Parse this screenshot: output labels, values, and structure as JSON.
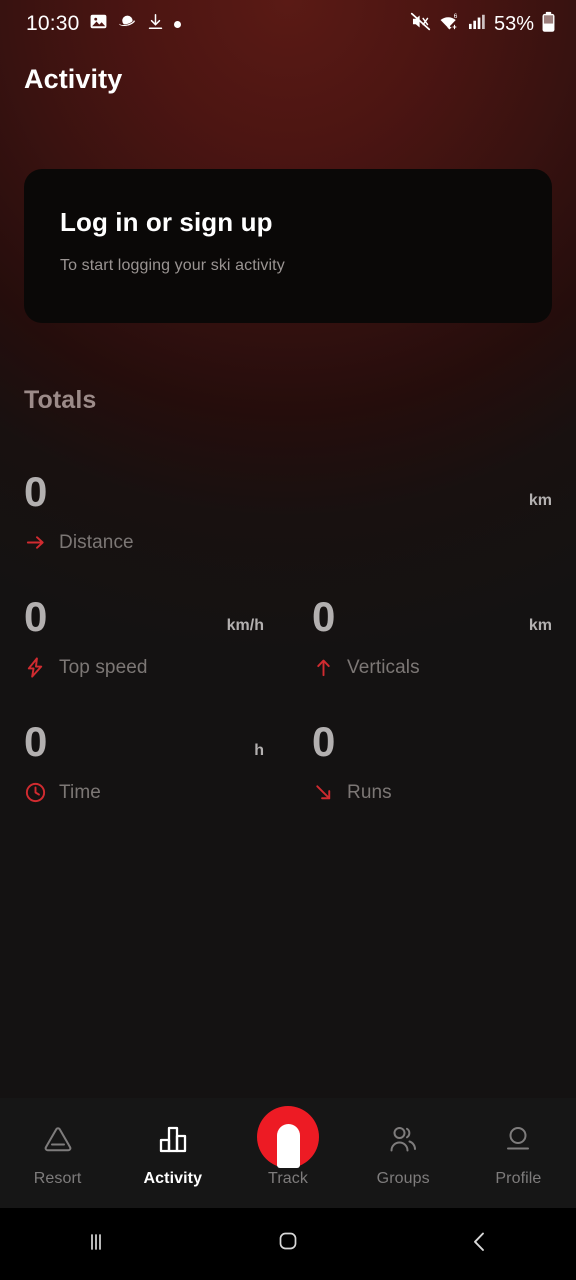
{
  "statusbar": {
    "time": "10:30",
    "left_icons": [
      "image-icon",
      "saturn-icon",
      "download-icon",
      "dot-icon"
    ],
    "right_icons": [
      "mute-icon",
      "wifi-6-icon",
      "signal-bars-icon"
    ],
    "battery_percent": "53%",
    "battery_icon": "battery-icon"
  },
  "header": {
    "title": "Activity"
  },
  "login_card": {
    "title": "Log in or sign up",
    "subtitle": "To start logging your ski activity",
    "background": "#0a0807"
  },
  "totals": {
    "heading": "Totals",
    "stats": [
      {
        "value": "0",
        "unit": "km",
        "label": "Distance",
        "icon": "arrow-right-icon",
        "width": "full"
      },
      {
        "value": "0",
        "unit": "km/h",
        "label": "Top speed",
        "icon": "lightning-icon",
        "width": "half"
      },
      {
        "value": "0",
        "unit": "km",
        "label": "Verticals",
        "icon": "arrow-up-icon",
        "width": "half"
      },
      {
        "value": "0",
        "unit": "h",
        "label": "Time",
        "icon": "clock-icon",
        "width": "half"
      },
      {
        "value": "0",
        "unit": "",
        "label": "Runs",
        "icon": "arrow-down-right-icon",
        "width": "half"
      }
    ]
  },
  "bottom_nav": {
    "items": [
      {
        "label": "Resort",
        "icon": "mountain-icon",
        "active": false
      },
      {
        "label": "Activity",
        "icon": "bar-chart-icon",
        "active": true
      },
      {
        "label": "Track",
        "icon": "track-record-icon",
        "active": false
      },
      {
        "label": "Groups",
        "icon": "people-icon",
        "active": false
      },
      {
        "label": "Profile",
        "icon": "person-icon",
        "active": false
      }
    ]
  },
  "system_nav": {
    "items": [
      "recents-icon",
      "home-icon",
      "back-icon"
    ]
  },
  "colors": {
    "accent_red": "#ed1b24",
    "icon_red": "#d12b30",
    "background_top": "#4c1512",
    "background_bottom": "#141212",
    "value_grey": "#b3b0b0",
    "label_grey": "#7c7775"
  }
}
